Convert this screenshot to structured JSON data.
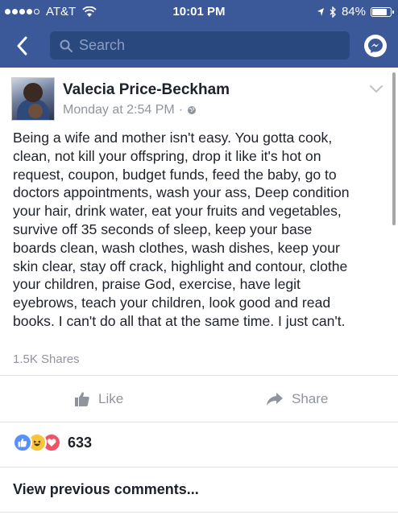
{
  "status_bar": {
    "carrier": "AT&T",
    "time": "10:01 PM",
    "battery": "84%",
    "battery_level": 0.84,
    "signal_bars": 4,
    "signal_total": 5
  },
  "nav": {
    "search_placeholder": "Search"
  },
  "post": {
    "author": "Valecia Price-Beckham",
    "timestamp": "Monday at 2:54 PM",
    "meta_separator": "·",
    "privacy_icon": "globe-icon",
    "text": "Being a wife and mother isn't easy. You gotta cook,\nclean, not kill your offspring, drop it like it's hot on\nrequest, coupon, budget funds, feed the baby, go to\ndoctors appointments, wash your ass, Deep condition\nyour hair, drink water, eat your fruits and vegetables,\nsurvive off 35 seconds of sleep, keep your base\nboards clean, wash clothes, wash dishes, keep your\nskin clear, stay off crack, highlight and contour, clothe\nyour children, praise God, exercise, have legit\neyebrows, teach your children, look good and read\nbooks. I can't do all that at the same time. I just can't.",
    "shares": "1.5K Shares"
  },
  "actions": {
    "like_label": "Like",
    "share_label": "Share"
  },
  "reactions": {
    "icons": [
      "like-icon",
      "haha-icon",
      "love-icon"
    ],
    "count": "633"
  },
  "comments": {
    "view_previous": "View previous comments..."
  },
  "colors": {
    "brand": "#3b5998",
    "search_bg": "#29487d",
    "meta_text": "#90949c",
    "like_blue": "#5890ff",
    "haha_yellow": "#f7c43b",
    "love_red": "#f25268"
  }
}
